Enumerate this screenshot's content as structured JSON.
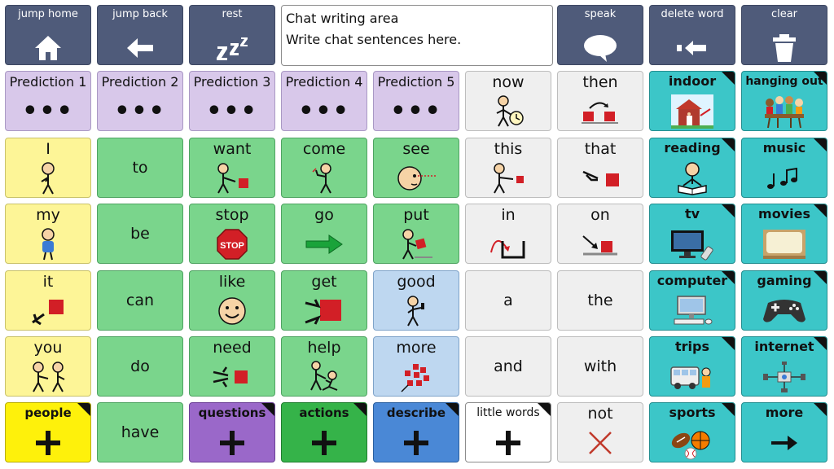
{
  "nav": {
    "jump_home": "jump home",
    "jump_back": "jump back",
    "rest": "rest",
    "speak": "speak",
    "delete_word": "delete word",
    "clear": "clear"
  },
  "chat": {
    "title": "Chat writing area",
    "placeholder": "Write chat sentences here."
  },
  "predictions": [
    "Prediction 1",
    "Prediction 2",
    "Prediction 3",
    "Prediction 4",
    "Prediction 5"
  ],
  "prediction_dots": "•••",
  "row1": {
    "now": "now",
    "then": "then",
    "indoor": "indoor",
    "hanging_out": "hanging out"
  },
  "row2": {
    "i": "I",
    "to": "to",
    "want": "want",
    "come": "come",
    "see": "see",
    "this": "this",
    "that": "that",
    "reading": "reading",
    "music": "music"
  },
  "row3": {
    "my": "my",
    "be": "be",
    "stop": "stop",
    "go": "go",
    "put": "put",
    "in": "in",
    "on": "on",
    "tv": "tv",
    "movies": "movies"
  },
  "row4": {
    "it": "it",
    "can": "can",
    "like": "like",
    "get": "get",
    "good": "good",
    "a": "a",
    "the": "the",
    "computer": "computer",
    "gaming": "gaming"
  },
  "row5": {
    "you": "you",
    "do": "do",
    "need": "need",
    "help": "help",
    "more": "more",
    "and": "and",
    "with": "with",
    "trips": "trips",
    "internet": "internet"
  },
  "row6": {
    "people": "people",
    "have": "have",
    "questions": "questions",
    "actions": "actions",
    "describe": "describe",
    "little_words": "little words",
    "not": "not",
    "sports": "sports",
    "more": "more"
  },
  "stop_sign_text": "STOP",
  "colors": {
    "nav": "#4f5b7a",
    "prediction": "#d8c8ea",
    "pronoun": "#fdf597",
    "verb": "#7ad58c",
    "little_word": "#efefef",
    "describe": "#bed7f0",
    "topic": "#3cc6c8"
  }
}
